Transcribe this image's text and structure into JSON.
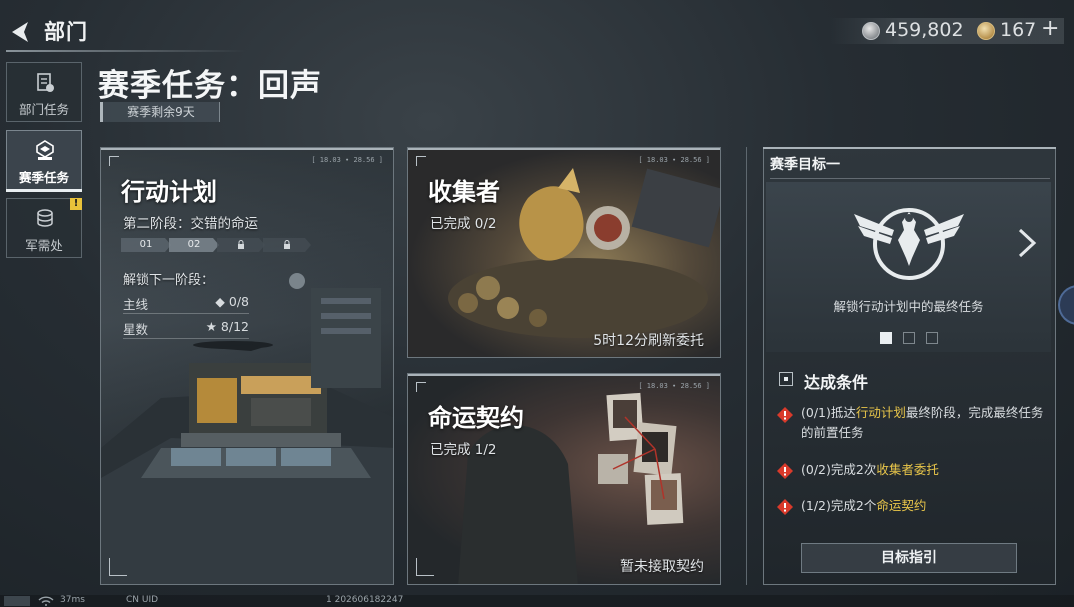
{
  "header": {
    "back_label": "部门",
    "currency": [
      {
        "icon": "silver-coin-icon",
        "value": "459,802"
      },
      {
        "icon": "gold-coin-icon",
        "value": "167"
      }
    ],
    "plus": "+"
  },
  "sidebar": {
    "items": [
      {
        "label": "部门任务",
        "icon": "mission-doc-icon",
        "active": false
      },
      {
        "label": "赛季任务",
        "icon": "season-emblem-icon",
        "active": true
      },
      {
        "label": "军需处",
        "icon": "supply-stack-icon",
        "active": false,
        "alert": "!"
      }
    ]
  },
  "season": {
    "title": "赛季任务：回声",
    "remaining": "赛季剩余9天"
  },
  "cards": {
    "plan": {
      "title": "行动计划",
      "stage_label": "第二阶段：交错的命运",
      "stages": [
        "01",
        "02",
        "lock",
        "lock"
      ],
      "unlock_label": "解锁下一阶段：",
      "rows": [
        {
          "label": "主线",
          "value": "◆ 0/8"
        },
        {
          "label": "星数",
          "value": "★ 8/12"
        }
      ]
    },
    "collector": {
      "title": "收集者",
      "status": "已完成 0/2",
      "footer": "5时12分刷新委托"
    },
    "contract": {
      "title": "命运契约",
      "status": "已完成 1/2",
      "footer": "暂未接取契约"
    },
    "meta_right": "[ 18.03 ∙ 28.56 ]"
  },
  "goal": {
    "title": "赛季目标一",
    "description": "解锁行动计划中的最终任务",
    "page_count": 3,
    "active_page": 1,
    "conditions_title": "达成条件",
    "conditions": [
      {
        "prefix": "(0/1)抵达",
        "highlight": "行动计划",
        "suffix": "最终阶段，完成最终任务的前置任务"
      },
      {
        "prefix": "(0/2)完成2次",
        "highlight": "收集者委托",
        "suffix": ""
      },
      {
        "prefix": "(1/2)完成2个",
        "highlight": "命运契约",
        "suffix": ""
      }
    ],
    "guide_button": "目标指引"
  },
  "status": {
    "ping": "37ms",
    "uid_label": "CN UID",
    "uid_value": "1 202606182247"
  },
  "colors": {
    "highlight": "#e8c54a",
    "warning": "#d93a2b",
    "bg": "#262d33"
  }
}
